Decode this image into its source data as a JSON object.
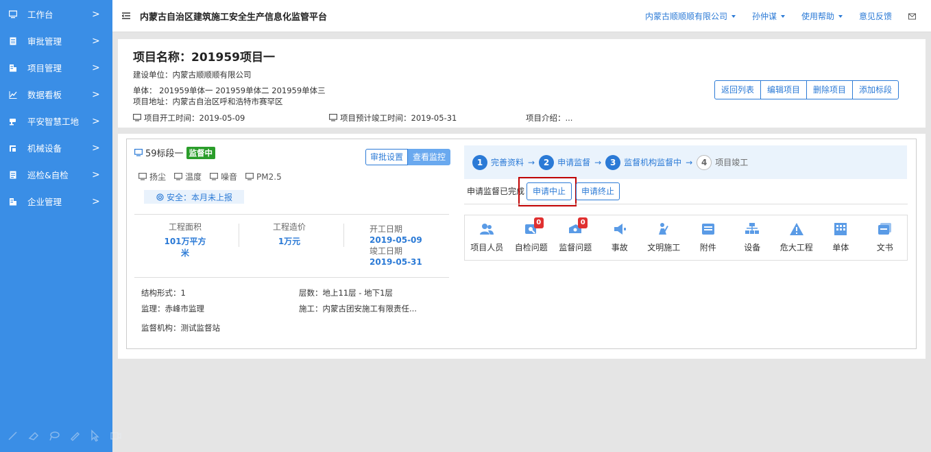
{
  "sidebar": {
    "items": [
      {
        "label": "工作台",
        "icon": "monitor-icon"
      },
      {
        "label": "审批管理",
        "icon": "document-icon"
      },
      {
        "label": "项目管理",
        "icon": "building-icon"
      },
      {
        "label": "数据看板",
        "icon": "chart-icon"
      },
      {
        "label": "平安智慧工地",
        "icon": "camera-icon"
      },
      {
        "label": "机械设备",
        "icon": "machine-icon"
      },
      {
        "label": "巡检&自检",
        "icon": "checklist-icon"
      },
      {
        "label": "企业管理",
        "icon": "company-icon"
      }
    ],
    "arrow": ">"
  },
  "header": {
    "title": "内蒙古自治区建筑施工安全生产信息化监管平台",
    "company": "内蒙古顺顺顺有限公司",
    "user": "孙仲谋",
    "help": "使用帮助",
    "feedback": "意见反馈"
  },
  "project": {
    "title": "项目名称：201959项目一",
    "builder": "建设单位：内蒙古顺顺顺有限公司",
    "units": "单体：  201959单体一  201959单体二  201959单体三",
    "address": "项目地址：内蒙古自治区呼和浩特市赛罕区",
    "start_date": "项目开工时间：2019-05-09",
    "end_date": "项目预计竣工时间：2019-05-31",
    "intro": "项目介绍：..."
  },
  "header_buttons": {
    "back": "返回列表",
    "edit": "编辑项目",
    "delete": "删除项目",
    "add": "添加标段"
  },
  "section": {
    "name": "59标段一",
    "status": "监督中",
    "approve_settings": "审批设置",
    "view_monitor": "查看监控",
    "sensors": [
      "扬尘",
      "温度",
      "噪音",
      "PM2.5"
    ],
    "safety": "安全：本月未上报",
    "stats": {
      "area_label": "工程面积",
      "area_value": "101万平方米",
      "cost_label": "工程造价",
      "cost_value": "1万元",
      "start_label": "开工日期",
      "start_value": "2019-05-09",
      "end_label": "竣工日期",
      "end_value": "2019-05-31"
    },
    "structure": "结构形式：1",
    "floors": "层数：地上11层 - 地下1层",
    "supervisor": "监理：赤峰市监理",
    "construction": "施工：内蒙古团安施工有限责任...",
    "agency": "监督机构：测试监督站"
  },
  "progress": {
    "steps": [
      {
        "num": "1",
        "label": "完善资料",
        "active": true
      },
      {
        "num": "2",
        "label": "申请监督",
        "active": true
      },
      {
        "num": "3",
        "label": "监督机构监督中",
        "active": true
      },
      {
        "num": "4",
        "label": "项目竣工",
        "active": false
      }
    ],
    "arrow": "→",
    "status_text": "申请监督已完成",
    "suspend": "申请中止",
    "terminate": "申请终止"
  },
  "functions": [
    {
      "label": "项目人员",
      "icon": "people-icon",
      "badge": null
    },
    {
      "label": "自检问题",
      "icon": "inspect-icon",
      "badge": "0"
    },
    {
      "label": "监督问题",
      "icon": "supervise-icon",
      "badge": "0"
    },
    {
      "label": "事故",
      "icon": "megaphone-icon",
      "badge": null
    },
    {
      "label": "文明施工",
      "icon": "worker-icon",
      "badge": null
    },
    {
      "label": "附件",
      "icon": "attachment-icon",
      "badge": null
    },
    {
      "label": "设备",
      "icon": "device-icon",
      "badge": null
    },
    {
      "label": "危大工程",
      "icon": "warning-icon",
      "badge": null
    },
    {
      "label": "单体",
      "icon": "building-grid-icon",
      "badge": null
    },
    {
      "label": "文书",
      "icon": "document-stack-icon",
      "badge": null
    }
  ],
  "colors": {
    "sidebar": "#3a8ee6",
    "primary": "#2b7ad6",
    "status_green": "#2a9d2a",
    "highlight_red": "#c00000",
    "badge_red": "#e03030"
  }
}
